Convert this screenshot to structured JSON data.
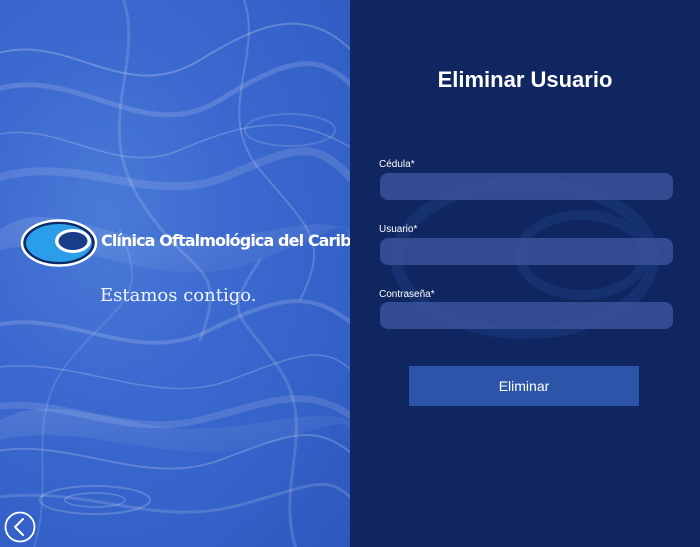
{
  "brand": {
    "name": "Clínica Oftalmológica del Caribe",
    "tagline": "Estamos contigo.",
    "logo_icon": "eye-logo-icon"
  },
  "navigation": {
    "back_icon": "chevron-left-circle-icon"
  },
  "form": {
    "title": "Eliminar Usuario",
    "fields": [
      {
        "label": "Cédula*",
        "value": "",
        "placeholder": ""
      },
      {
        "label": "Usuario*",
        "value": "",
        "placeholder": ""
      },
      {
        "label": "Contraseña*",
        "value": "",
        "placeholder": ""
      }
    ],
    "submit_label": "Eliminar"
  },
  "colors": {
    "left_panel": "#3d6ad0",
    "right_panel": "#102660",
    "input_bg": "#3d569e",
    "button_bg": "#2c55aa",
    "text": "#ffffff"
  }
}
